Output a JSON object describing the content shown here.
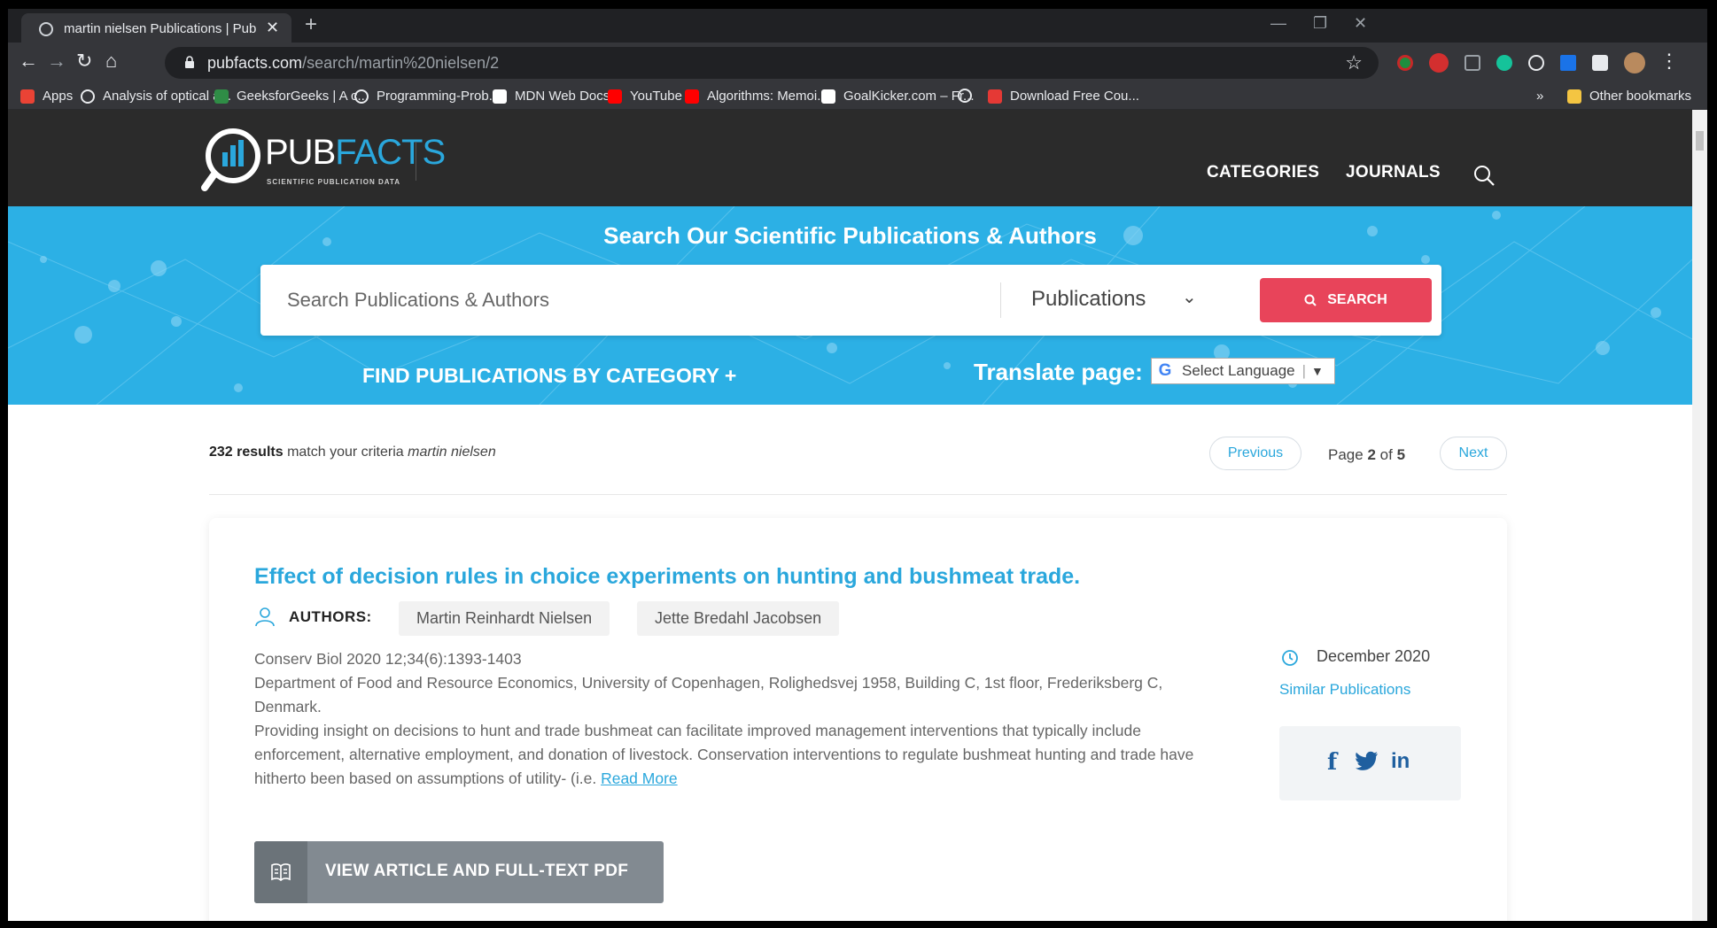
{
  "browser": {
    "tab_title": "martin nielsen Publications | Pub",
    "url_host": "pubfacts.com",
    "url_path": "/search/martin%20nielsen/2",
    "bookmarks": [
      {
        "label": "Apps",
        "icon": "apps-grid-icon",
        "color": "#ea4335"
      },
      {
        "label": "Analysis of optical a...",
        "icon": "globe-icon",
        "color": "#e8eaed"
      },
      {
        "label": "GeeksforGeeks | A c...",
        "icon": "gfg-icon",
        "color": "#2f8d46"
      },
      {
        "label": "Programming-Prob...",
        "icon": "github-icon",
        "color": "#e8eaed"
      },
      {
        "label": "MDN Web Docs",
        "icon": "mdn-icon",
        "color": "#ffffff"
      },
      {
        "label": "YouTube",
        "icon": "youtube-icon",
        "color": "#ff0000"
      },
      {
        "label": "Algorithms: Memoi...",
        "icon": "youtube-icon",
        "color": "#ff0000"
      },
      {
        "label": "GoalKicker.com – Fr...",
        "icon": "goalkicker-icon",
        "color": "#ffffff"
      },
      {
        "label": "",
        "icon": "globe-icon",
        "color": "#e8eaed"
      },
      {
        "label": "Download Free Cou...",
        "icon": "fco-icon",
        "color": "#e53935"
      }
    ],
    "overflow_label": "»",
    "other_bookmarks": "Other bookmarks"
  },
  "site": {
    "logo_pub": "PUB",
    "logo_facts": "FACTS",
    "logo_tagline": "SCIENTIFIC PUBLICATION DATA",
    "nav": {
      "categories": "CATEGORIES",
      "journals": "JOURNALS"
    },
    "brand_blue": "#2aa7dc",
    "accent_red": "#e8445a"
  },
  "hero": {
    "title": "Search Our Scientific Publications & Authors",
    "search_placeholder": "Search Publications & Authors",
    "type_selected": "Publications",
    "search_button": "SEARCH",
    "find_by_category": "FIND PUBLICATIONS BY CATEGORY +",
    "translate_label": "Translate page:",
    "language_select": "Select Language"
  },
  "results": {
    "count": "232 results",
    "criteria_text": "match your criteria",
    "query": "martin nielsen",
    "prev": "Previous",
    "next": "Next",
    "page_prefix": "Page",
    "page_current": "2",
    "page_of": "of",
    "page_total": "5"
  },
  "article": {
    "title": "Effect of decision rules in choice experiments on hunting and bushmeat trade.",
    "authors_label": "AUTHORS:",
    "authors": [
      "Martin Reinhardt Nielsen",
      "Jette Bredahl Jacobsen"
    ],
    "journal": "Conserv Biol 2020 12;34(6):1393-1403",
    "affiliation": "Department of Food and Resource Economics, University of Copenhagen, Rolighedsvej 1958, Building C, 1st floor, Frederiksberg C, Denmark.",
    "abstract": "Providing insight on decisions to hunt and trade bushmeat can facilitate improved management interventions that typically include enforcement, alternative employment, and donation of livestock. Conservation interventions to regulate bushmeat hunting and trade have hitherto been based on assumptions of utility- (i.e.",
    "read_more": "Read More",
    "date": "December 2020",
    "similar": "Similar Publications",
    "view_button": "VIEW ARTICLE AND FULL-TEXT PDF"
  }
}
